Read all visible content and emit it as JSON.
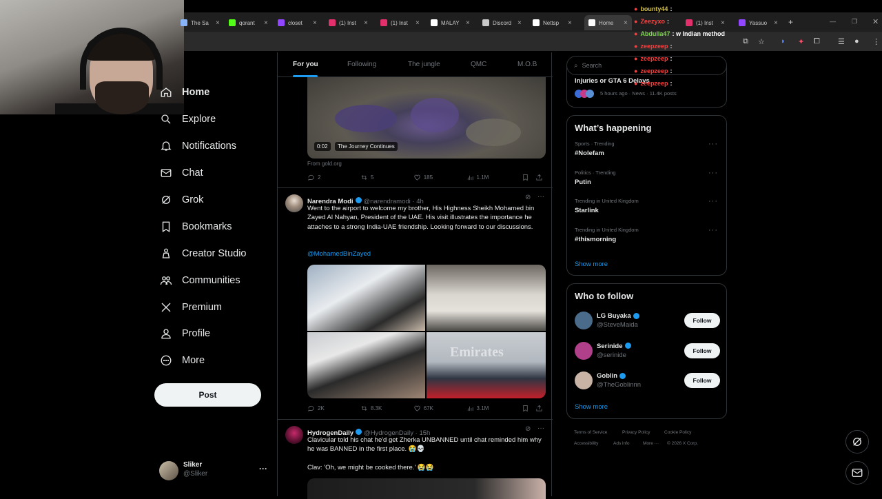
{
  "browser": {
    "tabs": [
      {
        "label": "The Sa",
        "color": "#8ab4f8"
      },
      {
        "label": "qorant",
        "color": "#53fc18"
      },
      {
        "label": "closet",
        "color": "#9146ff"
      },
      {
        "label": "(1) Inst",
        "color": "#e1306c"
      },
      {
        "label": "(1) Inst",
        "color": "#e1306c"
      },
      {
        "label": "MALAY",
        "color": "#ffffff"
      },
      {
        "label": "Discord",
        "color": "#c8c8c8"
      },
      {
        "label": "Nettsp",
        "color": "#ffffff"
      },
      {
        "label": "Home",
        "color": "#ffffff",
        "active": true
      },
      {
        "label": "(1) Inst",
        "color": "#e1306c"
      },
      {
        "label": "Yassuo",
        "color": "#9146ff"
      }
    ],
    "new_tab": "+"
  },
  "chat_overlay": [
    {
      "user": "bounty44",
      "msg": ":",
      "color": "#d4c24a"
    },
    {
      "user": "Zeezyxo",
      "msg": ":",
      "color": "#ff4444"
    },
    {
      "user": "Abdulla47",
      "msg": ": w Indian method",
      "color": "#7fd34e"
    },
    {
      "user": "zeepzeep",
      "msg": ":",
      "color": "#ff3b3b"
    },
    {
      "user": "zeepzeep",
      "msg": ":",
      "color": "#ff3b3b"
    },
    {
      "user": "zeepzeep",
      "msg": ":",
      "color": "#ff3b3b"
    },
    {
      "user": "zeepzeep",
      "msg": ":",
      "color": "#ff3b3b"
    }
  ],
  "nav": {
    "items": [
      {
        "label": "Home",
        "icon": "home-icon"
      },
      {
        "label": "Explore",
        "icon": "search-icon"
      },
      {
        "label": "Notifications",
        "icon": "bell-icon"
      },
      {
        "label": "Chat",
        "icon": "mail-icon"
      },
      {
        "label": "Grok",
        "icon": "grok-icon"
      },
      {
        "label": "Bookmarks",
        "icon": "bookmark-icon"
      },
      {
        "label": "Creator Studio",
        "icon": "creator-icon"
      },
      {
        "label": "Communities",
        "icon": "people-icon"
      },
      {
        "label": "Premium",
        "icon": "x-logo-icon"
      },
      {
        "label": "Profile",
        "icon": "person-icon"
      },
      {
        "label": "More",
        "icon": "more-circle-icon"
      }
    ],
    "post_label": "Post",
    "profile": {
      "name": "Sliker",
      "handle": "@Sliker",
      "more": "···"
    }
  },
  "feed": {
    "tabs": [
      "For you",
      "Following",
      "The jungle",
      "QMC",
      "M.O.B"
    ],
    "first_tweet": {
      "video_time": "0:02",
      "video_caption": "The Journey Continues",
      "source": "From gold.org",
      "replies": "2",
      "reposts": "5",
      "likes": "185",
      "views": "1.1M"
    },
    "tweet2": {
      "name": "Narendra Modi",
      "handle": "@narendramodi · 4h",
      "text": "Went to the airport to welcome my brother, His Highness Sheikh Mohamed bin Zayed Al Nahyan, President of the UAE. His visit illustrates the importance he attaches to a strong India-UAE friendship. Looking forward to our discussions.",
      "mention": "@MohamedBinZayed",
      "replies": "2K",
      "reposts": "8.3K",
      "likes": "67K",
      "views": "3.1M",
      "image_text": "Emirates"
    },
    "tweet3": {
      "name": "HydrogenDaily",
      "handle": "@HydrogenDaily · 15h",
      "text": "Clavicular told his chat he'd get Zherka UNBANNED until chat reminded him why he was BANNED in the first place. 😭💀",
      "text2": "Clav: 'Oh, we might be cooked there.' 😭😭"
    }
  },
  "right": {
    "search_placeholder": "Search",
    "top_trend": {
      "title": "Injuries or GTA 6 Delays",
      "meta": "5 hours ago · News · 11.4K posts"
    },
    "happening_title": "What’s happening",
    "trends": [
      {
        "context": "Sports · Trending",
        "title": "#Nolefam"
      },
      {
        "context": "Politics · Trending",
        "title": "Putin"
      },
      {
        "context": "Trending in United Kingdom",
        "title": "Starlink"
      },
      {
        "context": "Trending in United Kingdom",
        "title": "#thismorning"
      }
    ],
    "show_more": "Show more",
    "wtf_title": "Who to follow",
    "follow_label": "Follow",
    "suggestions": [
      {
        "name": "LG Buyaka",
        "handle": "@SteveMaida",
        "color": "#4a6b8a"
      },
      {
        "name": "Serinide",
        "handle": "@serinide",
        "color": "#b0408a"
      },
      {
        "name": "Goblin",
        "handle": "@TheGoblinnn",
        "color": "#c9b3a5"
      }
    ],
    "footer": [
      "Terms of Service",
      "Privacy Policy",
      "Cookie Policy",
      "Accessibility",
      "Ads info",
      "More ···",
      "© 2026 X Corp."
    ]
  }
}
